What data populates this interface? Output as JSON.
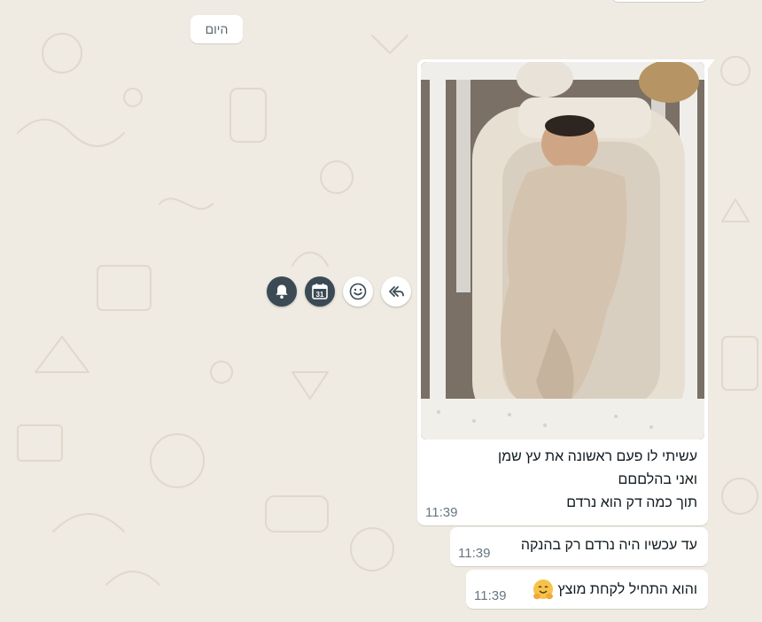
{
  "chat": {
    "date_divider": "היום",
    "messages": [
      {
        "kind": "image",
        "caption": "עשיתי לו פעם ראשונה את עץ שמן\nואני בהלםםם\nתוך כמה דק הוא נרדם",
        "time": "11:39"
      },
      {
        "kind": "text",
        "text": "עד עכשיו היה נרדם רק בהנקה",
        "time": "11:39"
      },
      {
        "kind": "text",
        "text": "והוא התחיל לקחת מוצץ",
        "emoji": "hugging-face",
        "time": "11:39"
      }
    ]
  },
  "hover_actions": {
    "bell_icon": "bell-icon",
    "calendar_icon": "calendar-icon",
    "calendar_day": "31",
    "emoji_icon": "smiley-icon",
    "reply_icon": "reply-all-icon"
  },
  "colors": {
    "background": "#efeae2",
    "bubble": "#ffffff",
    "timestamp": "#667781",
    "action_dark": "#3b4a54"
  }
}
